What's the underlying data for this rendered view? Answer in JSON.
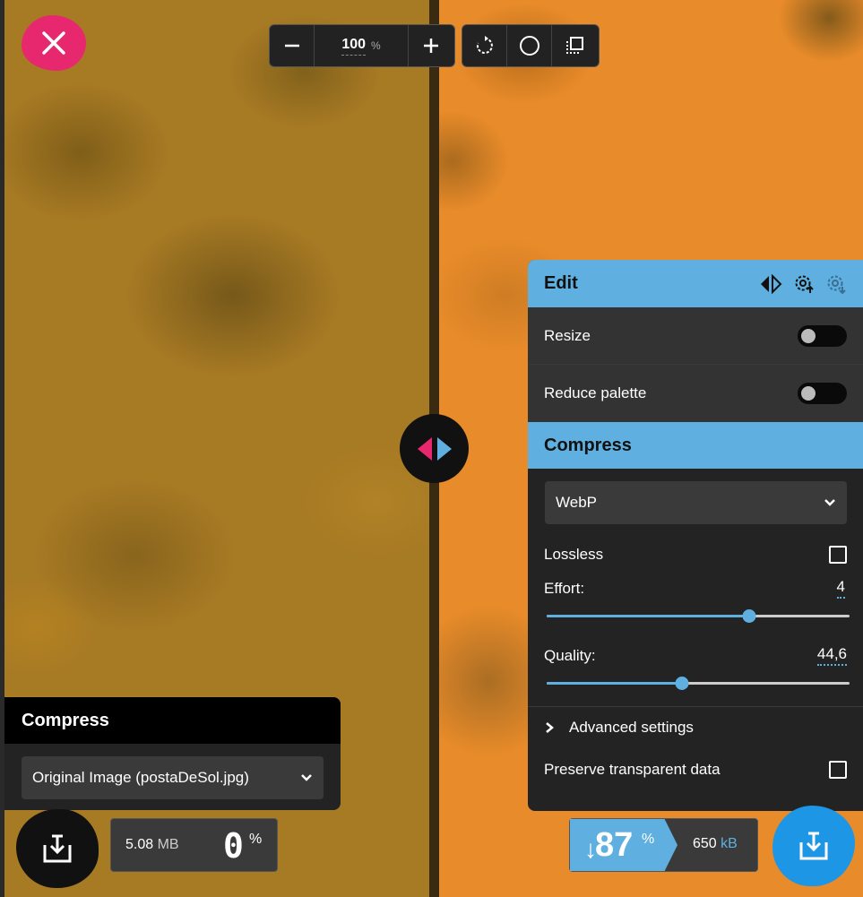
{
  "toolbar": {
    "zoom_value": "100",
    "zoom_unit": "%"
  },
  "edit_panel": {
    "title": "Edit",
    "resize_label": "Resize",
    "reduce_palette_label": "Reduce palette",
    "compress_title": "Compress",
    "format_value": "WebP",
    "lossless_label": "Lossless",
    "effort_label": "Effort:",
    "effort_value": "4",
    "effort_fraction": 0.67,
    "quality_label": "Quality:",
    "quality_value": "44,6",
    "quality_fraction": 0.446,
    "advanced_label": "Advanced settings",
    "preserve_label": "Preserve transparent data"
  },
  "left_panel": {
    "title": "Compress",
    "select_value": "Original Image (postaDeSol.jpg)",
    "size_value": "5.08",
    "size_unit": "MB",
    "percent": "0",
    "percent_sign": "%"
  },
  "right_stats": {
    "arrow": "↓",
    "percent": "87",
    "percent_sign": "%",
    "size_value": "650",
    "size_unit": "kB"
  },
  "colors": {
    "accent_blue": "#5fb0e0",
    "close_pink": "#e8286e",
    "download_blue": "#1e96e6"
  },
  "icons": [
    "close-icon",
    "zoom-out-icon",
    "zoom-in-icon",
    "rotate-icon",
    "background-toggle-icon",
    "crop-icon",
    "split-view-icon",
    "settings-upload-icon",
    "settings-download-icon",
    "chevron-down-icon",
    "chevron-right-icon",
    "download-icon"
  ]
}
